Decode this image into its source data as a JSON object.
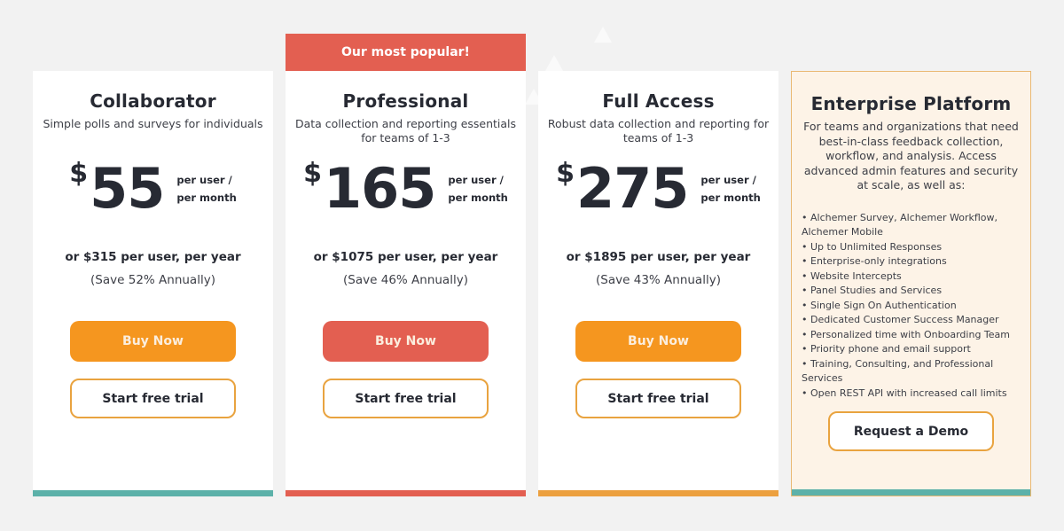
{
  "colors": {
    "orange": "#f5961f",
    "red": "#e35f51",
    "teal": "#5cb1a9",
    "orange_bar": "#eca03f",
    "enterprise_bg": "#fdf3e7",
    "background": "#f2f2f2"
  },
  "popular_badge": "Our most popular!",
  "plans": [
    {
      "title": "Collaborator",
      "description": "Simple polls and surveys for individuals",
      "currency": "$",
      "price": "55",
      "unit_line1": "per user /",
      "unit_line2": "per month",
      "yearly": "or $315 per user, per year",
      "save": "(Save 52% Annually)",
      "buy_label": "Buy Now",
      "trial_label": "Start free trial"
    },
    {
      "title": "Professional",
      "description": "Data collection and reporting essentials for teams of 1-3",
      "currency": "$",
      "price": "165",
      "unit_line1": "per user /",
      "unit_line2": "per month",
      "yearly": "or $1075 per user, per year",
      "save": "(Save 46% Annually)",
      "buy_label": "Buy Now",
      "trial_label": "Start free trial"
    },
    {
      "title": "Full Access",
      "description": "Robust data collection and reporting for teams of 1-3",
      "currency": "$",
      "price": "275",
      "unit_line1": "per user /",
      "unit_line2": "per month",
      "yearly": "or $1895 per user, per year",
      "save": "(Save 43% Annually)",
      "buy_label": "Buy Now",
      "trial_label": "Start free trial"
    }
  ],
  "enterprise": {
    "title": "Enterprise Platform",
    "description": "For teams and organizations that need best-in-class feedback collection, workflow, and analysis. Access advanced admin features and security at scale, as well as:",
    "features": [
      "Alchemer Survey, Alchemer Workflow, Alchemer Mobile",
      "Up to Unlimited Responses",
      "Enterprise-only integrations",
      "Website Intercepts",
      "Panel Studies and Services",
      "Single Sign On Authentication",
      "Dedicated Customer Success Manager",
      "Personalized time with Onboarding Team",
      "Priority phone and email support",
      "Training, Consulting, and Professional Services",
      "Open REST API with increased call limits"
    ],
    "demo_label": "Request a Demo"
  }
}
